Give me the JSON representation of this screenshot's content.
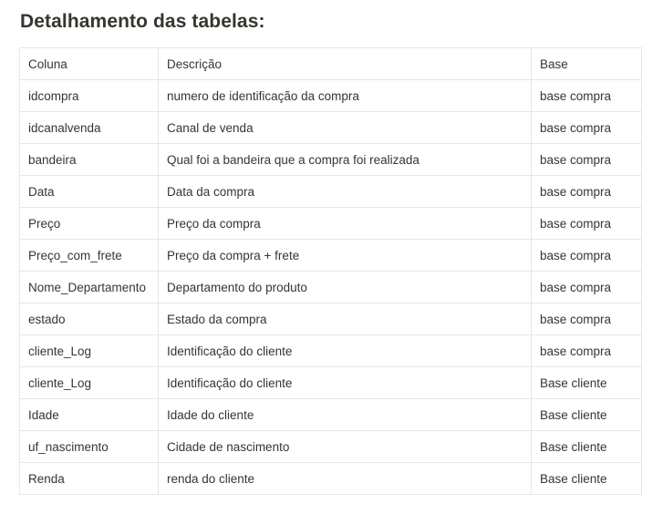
{
  "heading": "Detalhamento das tabelas:",
  "table": {
    "header": [
      "Coluna",
      "Descrição",
      "Base"
    ],
    "rows": [
      [
        "idcompra",
        "numero de identificação da compra",
        "base compra"
      ],
      [
        "idcanalvenda",
        "Canal de venda",
        "base compra"
      ],
      [
        "bandeira",
        "Qual foi a bandeira que a compra foi realizada",
        "base compra"
      ],
      [
        "Data",
        "Data da compra",
        "base compra"
      ],
      [
        "Preço",
        "Preço da compra",
        "base compra"
      ],
      [
        "Preço_com_frete",
        "Preço da compra + frete",
        "base compra"
      ],
      [
        "Nome_Departamento",
        "Departamento do produto",
        "base compra"
      ],
      [
        "estado",
        "Estado da compra",
        "base compra"
      ],
      [
        "cliente_Log",
        "Identificação do cliente",
        "base compra"
      ],
      [
        "cliente_Log",
        "Identificação do cliente",
        "Base cliente"
      ],
      [
        "Idade",
        "Idade do cliente",
        "Base cliente"
      ],
      [
        "uf_nascimento",
        "Cidade de nascimento",
        "Base cliente"
      ],
      [
        "Renda",
        "renda do cliente",
        "Base cliente"
      ]
    ]
  }
}
